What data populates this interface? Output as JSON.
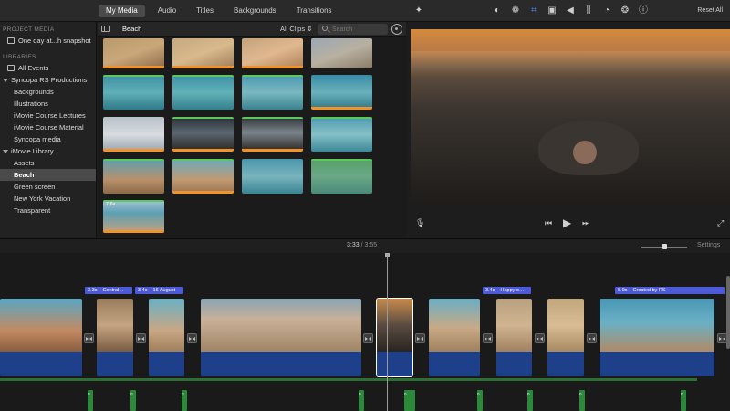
{
  "top_tabs": [
    "My Media",
    "Audio",
    "Titles",
    "Backgrounds",
    "Transitions"
  ],
  "viewer_tools": {
    "icons": [
      "magic-wand-icon",
      "color-balance-icon",
      "color-palette-icon",
      "crop-icon",
      "stabilization-icon",
      "volume-icon",
      "equalizer-icon",
      "speed-icon",
      "filter-icon",
      "info-icon"
    ],
    "reset_label": "Reset All"
  },
  "sidebar": {
    "project_header": "PROJECT MEDIA",
    "project_item": "One day at...h snapshot",
    "libraries_header": "LIBRARIES",
    "items": [
      {
        "label": "All Events",
        "level": 0,
        "icon": "events-icon"
      },
      {
        "label": "Syncopa RS Productions",
        "level": 0,
        "icon": "disclosure-triangle"
      },
      {
        "label": "Backgrounds",
        "level": 1
      },
      {
        "label": "Illustrations",
        "level": 1
      },
      {
        "label": "iMovie Course Lectures",
        "level": 1
      },
      {
        "label": "iMovie Course Material",
        "level": 1
      },
      {
        "label": "Syncopa media",
        "level": 1
      },
      {
        "label": "iMovie Library",
        "level": 0,
        "icon": "disclosure-triangle"
      },
      {
        "label": "Assets",
        "level": 1
      },
      {
        "label": "Beach",
        "level": 1,
        "selected": true
      },
      {
        "label": "Green screen",
        "level": 1
      },
      {
        "label": "New York Vacation",
        "level": 1
      },
      {
        "label": "Transparent",
        "level": 1
      }
    ]
  },
  "browser": {
    "title": "Beach",
    "filter": "All Clips",
    "search_placeholder": "Search",
    "thumbnail_duration": "7.6s"
  },
  "viewer": {
    "controls": [
      "microphone-icon",
      "skip-back-icon",
      "play-icon",
      "skip-forward-icon",
      "fullscreen-icon"
    ]
  },
  "timeline": {
    "current_time": "3:33",
    "total_time": "3:55",
    "settings_label": "Settings",
    "titles": [
      "3.3s – Central…",
      "3.4s – 16 August",
      "3.4s – Happy o…",
      "8.0s – Created by RS"
    ],
    "music_labels": [
      "0.",
      "0.",
      "0.",
      "0.",
      "0.",
      "0.",
      "0.",
      "0.",
      "0."
    ]
  },
  "colors": {
    "accent_title": "#4d5ad8",
    "audio_waveform": "#1e3f8a",
    "used_range": "#f0932b",
    "favorite": "#5ac85a",
    "music": "#2a8a3a"
  }
}
